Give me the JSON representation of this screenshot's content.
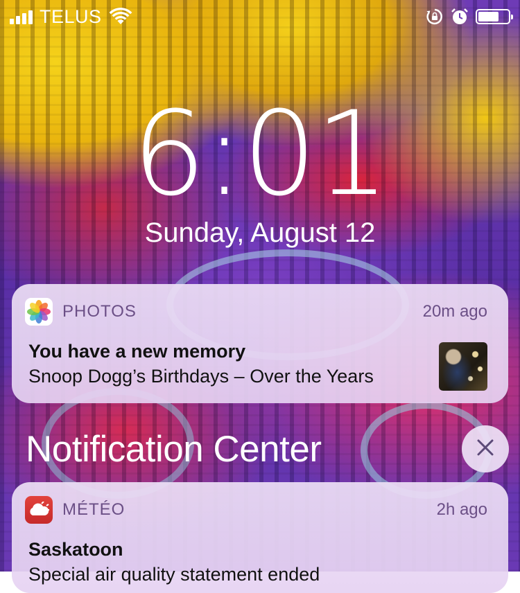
{
  "status_bar": {
    "carrier": "TELUS",
    "signal_icon": "signal-bars-icon",
    "wifi_icon": "wifi-icon",
    "orientation_lock_icon": "orientation-lock-icon",
    "alarm_icon": "alarm-clock-icon",
    "battery_icon": "battery-icon",
    "battery_level": 0.7
  },
  "lock_screen": {
    "time": "6:01",
    "date": "Sunday, August 12"
  },
  "notifications": [
    {
      "app_name": "PHOTOS",
      "icon": "photos-app-icon",
      "time_ago": "20m ago",
      "title": "You have a new memory",
      "text": "Snoop Dogg’s Birthdays – Over the Years",
      "thumbnail": "memory-thumbnail"
    },
    {
      "app_name": "MÉTÉO",
      "icon": "weather-app-icon",
      "time_ago": "2h ago",
      "title": "Saskatoon",
      "text": "Special air quality statement ended"
    }
  ],
  "notification_center": {
    "title": "Notification Center",
    "close_icon": "close-icon"
  }
}
